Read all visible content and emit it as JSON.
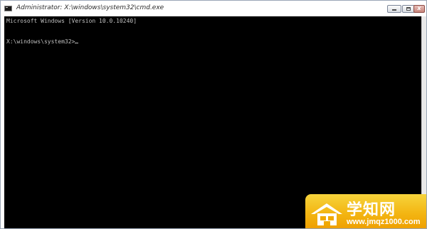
{
  "window": {
    "title": "Administrator: X:\\windows\\system32\\cmd.exe",
    "icon": "cmd-icon",
    "controls": {
      "minimize_icon": "minimize-icon",
      "maximize_icon": "maximize-icon",
      "close_icon": "close-icon",
      "close_glyph": "x"
    }
  },
  "console": {
    "lines": [
      "Microsoft Windows [Version 10.0.10240]",
      "X:\\windows\\system32>"
    ],
    "background": "#000000",
    "foreground": "#c0c0c0"
  },
  "watermark": {
    "brand": "学知网",
    "url": "www.jmqz1000.com",
    "color": "#f3b512"
  }
}
